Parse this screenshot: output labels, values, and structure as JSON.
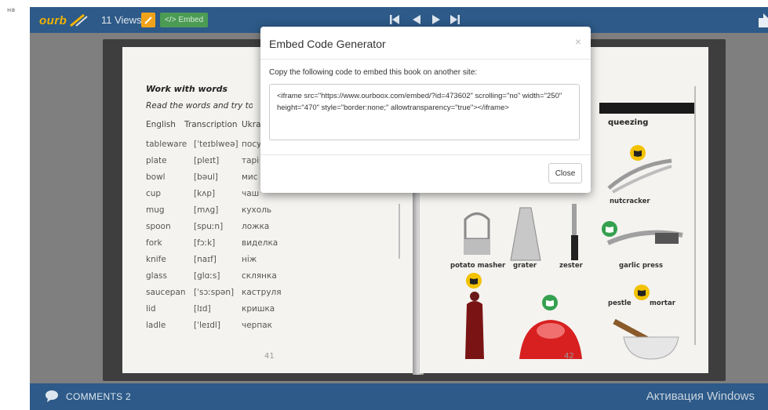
{
  "left_strip": {
    "tiny": "на"
  },
  "header": {
    "logo_text": "ourb",
    "views": "11 Views",
    "embed_label": "Embed"
  },
  "book": {
    "left_page": {
      "title": "Work with words",
      "instruction": "Read the words and try to reme",
      "headers": [
        "English",
        "Transcription",
        "Ukra"
      ],
      "rows": [
        [
          "tableware",
          "[ˈteɪblweə]",
          "посу"
        ],
        [
          "plate",
          "[pleɪt]",
          "тарі"
        ],
        [
          "bowl",
          "[bəul]",
          "мис"
        ],
        [
          "cup",
          "[kʌp]",
          "чаш"
        ],
        [
          "mug",
          "[mʌg]",
          "кухоль"
        ],
        [
          "spoon",
          "[spuːn]",
          "ложка"
        ],
        [
          "fork",
          "[fɔːk]",
          "виделка"
        ],
        [
          "knife",
          "[naɪf]",
          "ніж"
        ],
        [
          "glass",
          "[glɑːs]",
          "склянка"
        ],
        [
          "saucepan",
          "[ˈsɔːspən]",
          "каструля"
        ],
        [
          "lid",
          "[lɪd]",
          "кришка"
        ],
        [
          "ladle",
          "[ˈleɪdl]",
          "черпак"
        ]
      ],
      "page_number": "41"
    },
    "right_page": {
      "heading": "queezing",
      "labels": {
        "nutcracker": "nutcracker",
        "potato_masher": "potato masher",
        "grater": "grater",
        "zester": "zester",
        "garlic_press": "garlic press",
        "pestle": "pestle",
        "mortar": "mortar"
      },
      "page_number": "42"
    }
  },
  "comments": {
    "label": "COMMENTS 2",
    "watermark": "Активация Windows"
  },
  "modal": {
    "title": "Embed Code Generator",
    "close_x": "×",
    "instruction": "Copy the following code to embed this book on another site:",
    "code": "<iframe src=\"https://www.ourboox.com/embed/?id=473602\" scrolling=\"no\" width=\"250\" height=\"470\" style=\"border:none;\" allowtransparency=\"true\"></iframe>",
    "close_button": "Close"
  },
  "colors": {
    "bar": "#2d5a88",
    "logo": "#f2b300",
    "edit": "#f0a31a",
    "embed": "#4b9b55",
    "stage": "#7f7f7f"
  }
}
